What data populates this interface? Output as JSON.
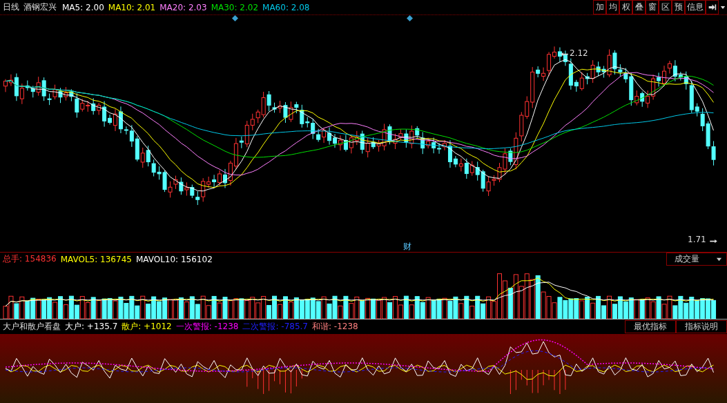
{
  "header": {
    "period": "日线",
    "name": "酒钢宏兴",
    "ma": [
      {
        "label": "MA5:",
        "value": "2.00",
        "color": "#ffffff"
      },
      {
        "label": "MA10:",
        "value": "2.01",
        "color": "#ffff00"
      },
      {
        "label": "MA20:",
        "value": "2.03",
        "color": "#ff80ff"
      },
      {
        "label": "MA30:",
        "value": "2.02",
        "color": "#00e000"
      },
      {
        "label": "MA60:",
        "value": "2.08",
        "color": "#00c8e8"
      }
    ]
  },
  "toolbar": [
    "加",
    "均",
    "权",
    "叠",
    "窗",
    "区",
    "预",
    "信息"
  ],
  "price_chart": {
    "high_label": "2.12",
    "low_label": "1.71",
    "event_label": "财"
  },
  "volume": {
    "items": [
      {
        "label": "总手:",
        "value": "154836",
        "color": "#ff3232"
      },
      {
        "label": "MAVOL5:",
        "value": "136745",
        "color": "#ffff00"
      },
      {
        "label": "MAVOL10:",
        "value": "156102",
        "color": "#ffffff"
      }
    ],
    "indicator_button": "成交量"
  },
  "indicator": {
    "title": "大户和散户看盘",
    "items": [
      {
        "label": "大户:",
        "value": "+135.7",
        "color": "#ffffff"
      },
      {
        "label": "散户:",
        "value": "+1012",
        "color": "#ffff00"
      },
      {
        "label": "一次警报:",
        "value": "-1238",
        "color": "#ff00ff"
      },
      {
        "label": "二次警报:",
        "value": "-785.7",
        "color": "#2020ff"
      },
      {
        "label": "和谐:",
        "value": "-1238",
        "color": "#ff8080"
      }
    ],
    "buttons": [
      "最优指标",
      "指标说明"
    ]
  }
}
